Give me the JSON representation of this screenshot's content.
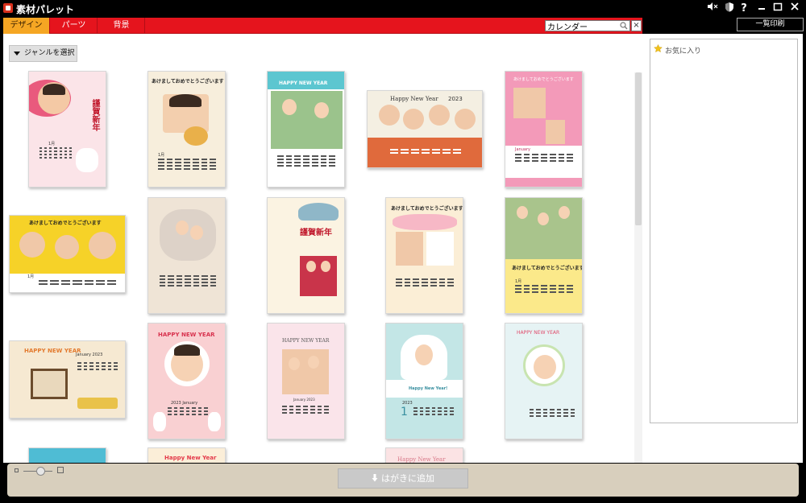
{
  "window": {
    "title": "素材パレット",
    "controls": [
      "mute",
      "info",
      "help",
      "minimize",
      "maximize",
      "close"
    ]
  },
  "tabs": [
    {
      "label": "デザイン",
      "active": true
    },
    {
      "label": "パーツ",
      "active": false
    },
    {
      "label": "背景",
      "active": false
    }
  ],
  "search": {
    "value": "カレンダー",
    "clear_label": "×"
  },
  "toolbar": {
    "print_list_label": "一覧印刷"
  },
  "genre": {
    "label": "ジャンルを選択"
  },
  "favorites": {
    "label": "お気に入り"
  },
  "bottom": {
    "add_label": "はがきに追加"
  },
  "cards": {
    "c1": {
      "title": "謹賀新年",
      "month": "1月"
    },
    "c2": {
      "title": "あけましておめでとうございます",
      "month": "1月"
    },
    "c3": {
      "title": "HAPPY NEW YEAR"
    },
    "c4": {
      "title": "Happy New Year",
      "year": "2023"
    },
    "c5": {
      "title": "あけましておめでとうございます",
      "month": "January"
    },
    "c6": {
      "title": "あけましておめでとうございます",
      "month": "1月"
    },
    "c8": {
      "title": "謹賀新年"
    },
    "c9": {
      "title": "あけましておめでとうございます"
    },
    "c10": {
      "title": "あけましておめでとうございます",
      "month": "1月"
    },
    "c11": {
      "title": "HAPPY NEW YEAR",
      "sub": "January 2023"
    },
    "c12": {
      "title": "HAPPY NEW YEAR",
      "sub": "2023 January"
    },
    "c13": {
      "title": "HAPPY NEW YEAR",
      "sub": "January 2023"
    },
    "c14": {
      "title": "Happy New Year!",
      "sub": "2023",
      "month": "1"
    },
    "c15": {
      "title": "HAPPY NEW YEAR"
    },
    "c17": {
      "title": "Happy New Year"
    },
    "c18": {
      "title": "Happy New Year"
    }
  },
  "colors": {
    "tab_bar": "#e5141d",
    "tab_active": "#f5a623",
    "bottom_bar": "#d8cfbd"
  }
}
